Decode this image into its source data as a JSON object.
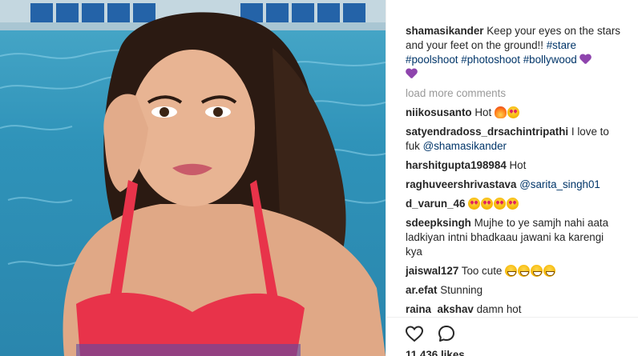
{
  "post": {
    "caption": {
      "username": "shamasikander",
      "text": "Keep your eyes on the stars and your feet on the ground!!",
      "hashtags": [
        "#stare",
        "#poolshoot",
        "#photoshoot",
        "#bollywood"
      ],
      "emoji": [
        "purple-heart",
        "purple-heart"
      ]
    },
    "load_more_label": "load more comments",
    "comments": [
      {
        "username": "niikosusanto",
        "text": "Hot",
        "emoji": [
          "fire",
          "heart-eyes"
        ]
      },
      {
        "username": "satyendradoss_drsachintripathi",
        "text": "I love to fuk",
        "mention": "@shamasikander",
        "emoji": []
      },
      {
        "username": "harshitgupta198984",
        "text": "Hot",
        "emoji": []
      },
      {
        "username": "raghuveershrivastava",
        "text": "",
        "mention": "@sarita_singh01",
        "emoji": []
      },
      {
        "username": "d_varun_46",
        "text": "",
        "emoji": [
          "heart-eyes",
          "heart-eyes",
          "heart-eyes",
          "heart-eyes"
        ]
      },
      {
        "username": "sdeepksingh",
        "text": "Mujhe to ye samjh nahi aata ladkiyan intni bhadkaau jawani ka karengi kya",
        "emoji": []
      },
      {
        "username": "jaiswal127",
        "text": "Too cute",
        "emoji": [
          "grin",
          "grin",
          "grin",
          "grin"
        ]
      },
      {
        "username": "ar.efat",
        "text": "Stunning",
        "emoji": []
      },
      {
        "username": "raina_akshav",
        "text": "damn hot",
        "emoji": []
      }
    ],
    "likes_label": "11,436 likes",
    "icons": {
      "like": "heart-icon",
      "comment": "comment-bubble-icon"
    }
  }
}
